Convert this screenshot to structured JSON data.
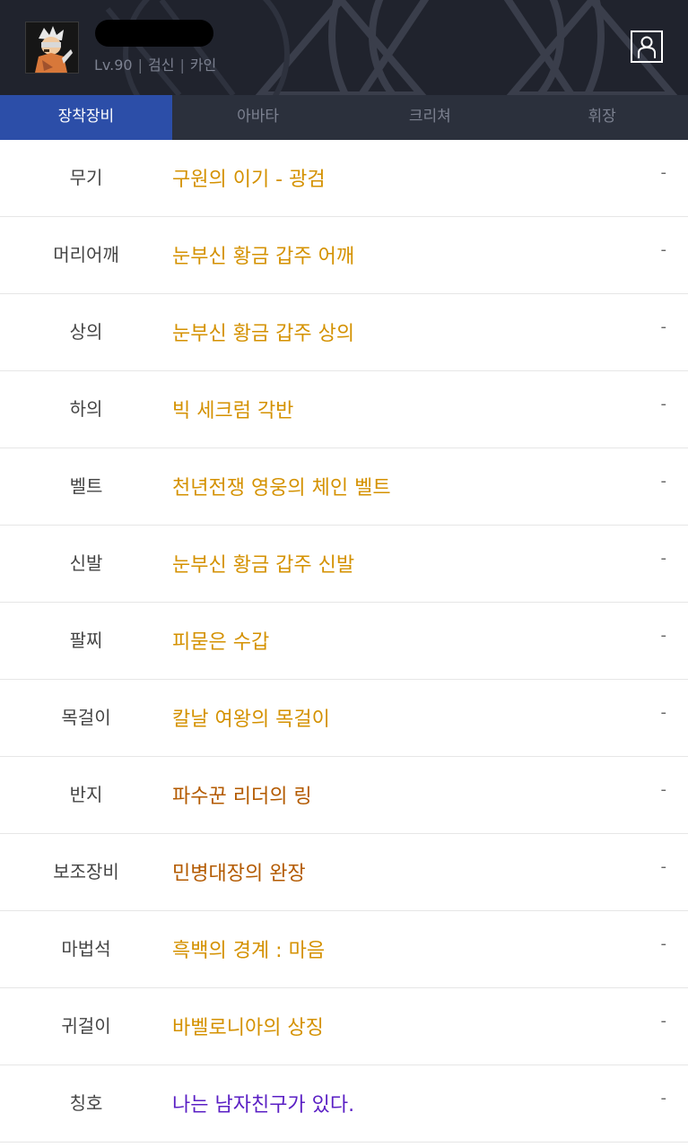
{
  "header": {
    "level": "Lv.90",
    "job": "검신",
    "server": "카인",
    "separator": "|"
  },
  "tabs": [
    {
      "label": "장착장비",
      "active": true
    },
    {
      "label": "아바타",
      "active": false
    },
    {
      "label": "크리쳐",
      "active": false
    },
    {
      "label": "휘장",
      "active": false
    }
  ],
  "colors": {
    "unique": "#d49100",
    "legendary": "#b35a00",
    "epic": "#5a1fc4",
    "tab_active": "#2c4ea8"
  },
  "equipment": [
    {
      "slot": "무기",
      "item": "구원의 이기 - 광검",
      "color": "#d49100",
      "value": "-"
    },
    {
      "slot": "머리어깨",
      "item": "눈부신 황금 갑주 어깨",
      "color": "#d49100",
      "value": "-"
    },
    {
      "slot": "상의",
      "item": "눈부신 황금 갑주 상의",
      "color": "#d49100",
      "value": "-"
    },
    {
      "slot": "하의",
      "item": "빅 세크럼 각반",
      "color": "#d49100",
      "value": "-"
    },
    {
      "slot": "벨트",
      "item": "천년전쟁 영웅의 체인 벨트",
      "color": "#d49100",
      "value": "-"
    },
    {
      "slot": "신발",
      "item": "눈부신 황금 갑주 신발",
      "color": "#d49100",
      "value": "-"
    },
    {
      "slot": "팔찌",
      "item": "피묻은 수갑",
      "color": "#d49100",
      "value": "-"
    },
    {
      "slot": "목걸이",
      "item": "칼날 여왕의 목걸이",
      "color": "#d49100",
      "value": "-"
    },
    {
      "slot": "반지",
      "item": "파수꾼 리더의 링",
      "color": "#b35a00",
      "value": "-"
    },
    {
      "slot": "보조장비",
      "item": "민병대장의 완장",
      "color": "#b35a00",
      "value": "-"
    },
    {
      "slot": "마법석",
      "item": "흑백의 경계 : 마음",
      "color": "#d49100",
      "value": "-"
    },
    {
      "slot": "귀걸이",
      "item": "바벨로니아의 상징",
      "color": "#d49100",
      "value": "-"
    },
    {
      "slot": "칭호",
      "item": "나는 남자친구가 있다.",
      "color": "#5a1fc4",
      "value": "-"
    }
  ]
}
